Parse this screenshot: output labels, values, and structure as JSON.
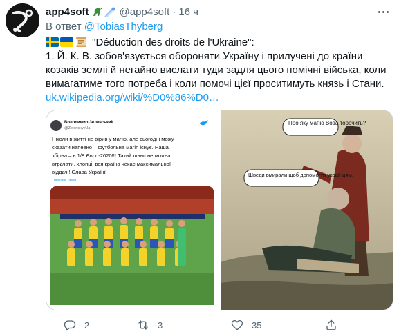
{
  "author": {
    "name": "app4soft",
    "handle": "@app4soft",
    "separator": "·",
    "time": "16 ч"
  },
  "reply": {
    "prefix": "В ответ",
    "mention": "@TobiasThyberg"
  },
  "tweet": {
    "title": "\"Déduction des droits de l'Ukraine\":",
    "line1": "1. Й. К. В. зобов'язується обороняти Україну і прилучені до країни",
    "line2": "козаків землі й негайно вислати туди задля цього помічні війська, коли",
    "line3": "вимагатиме того потреба і коли помочі цієї проситимуть князь і Стани.",
    "link": "uk.wikipedia.org/wiki/%D0%86%D0…"
  },
  "embedded_tweet": {
    "name": "Володимир Зеленський",
    "handle": "@ZelenskyyUa",
    "lines": [
      "Ніколи в житті не вірив у магію, але сьогодні можу",
      "сказати напевно – футбольна магія існує. Наша",
      "збірна – в 1/8 Євро-2020!!! Такий шанс не можна",
      "втрачати, хлопці, вся країна чекає максимальної",
      "віддачі! Слава Україні!"
    ],
    "translate": "Translate Tweet"
  },
  "meme": {
    "bubble_top": "Про яку магію Вова торочить?",
    "bubble_left": "Шведи вмирали щоб допомогти українцям."
  },
  "actions": {
    "replies": "2",
    "retweets": "3",
    "likes": "35"
  }
}
